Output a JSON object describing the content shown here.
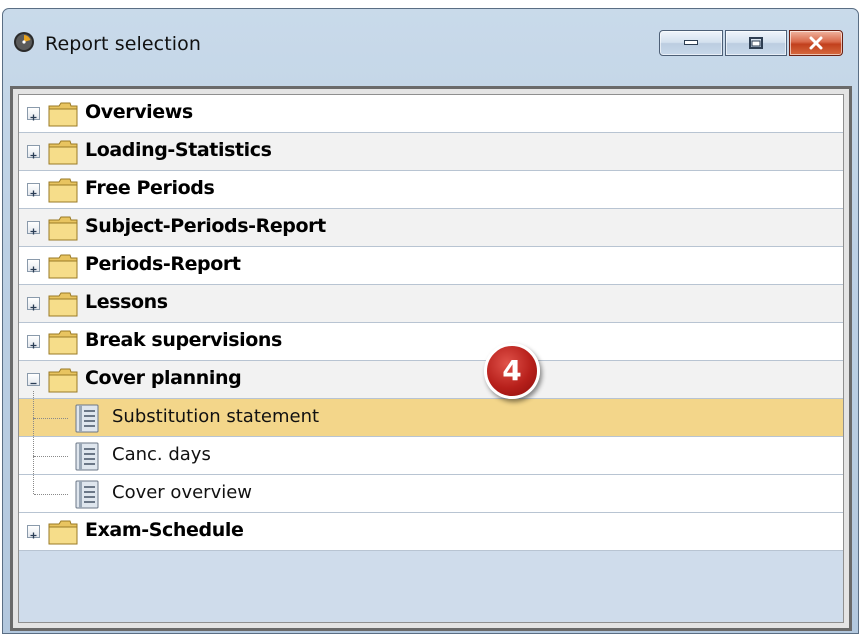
{
  "window": {
    "title": "Report selection",
    "icon": "clock-icon"
  },
  "controls": {
    "minimize": "minimize-icon",
    "maximize": "maximize-icon",
    "close": "close-icon"
  },
  "tree": {
    "items": [
      {
        "label": "Overviews",
        "type": "folder",
        "expanded": false
      },
      {
        "label": "Loading-Statistics",
        "type": "folder",
        "expanded": false
      },
      {
        "label": "Free Periods",
        "type": "folder",
        "expanded": false
      },
      {
        "label": "Subject-Periods-Report",
        "type": "folder",
        "expanded": false
      },
      {
        "label": "Periods-Report",
        "type": "folder",
        "expanded": false
      },
      {
        "label": "Lessons",
        "type": "folder",
        "expanded": false
      },
      {
        "label": "Break supervisions",
        "type": "folder",
        "expanded": false
      },
      {
        "label": "Cover planning",
        "type": "folder",
        "expanded": true
      },
      {
        "label": "Substitution statement",
        "type": "report",
        "selected": true
      },
      {
        "label": "Canc. days",
        "type": "report"
      },
      {
        "label": "Cover overview",
        "type": "report"
      },
      {
        "label": "Exam-Schedule",
        "type": "folder",
        "expanded": false
      }
    ]
  },
  "callout": {
    "number": "4"
  },
  "colors": {
    "selected_row": "#f3d68a",
    "badge": "#b7201b",
    "folder": "#f2d77a"
  }
}
